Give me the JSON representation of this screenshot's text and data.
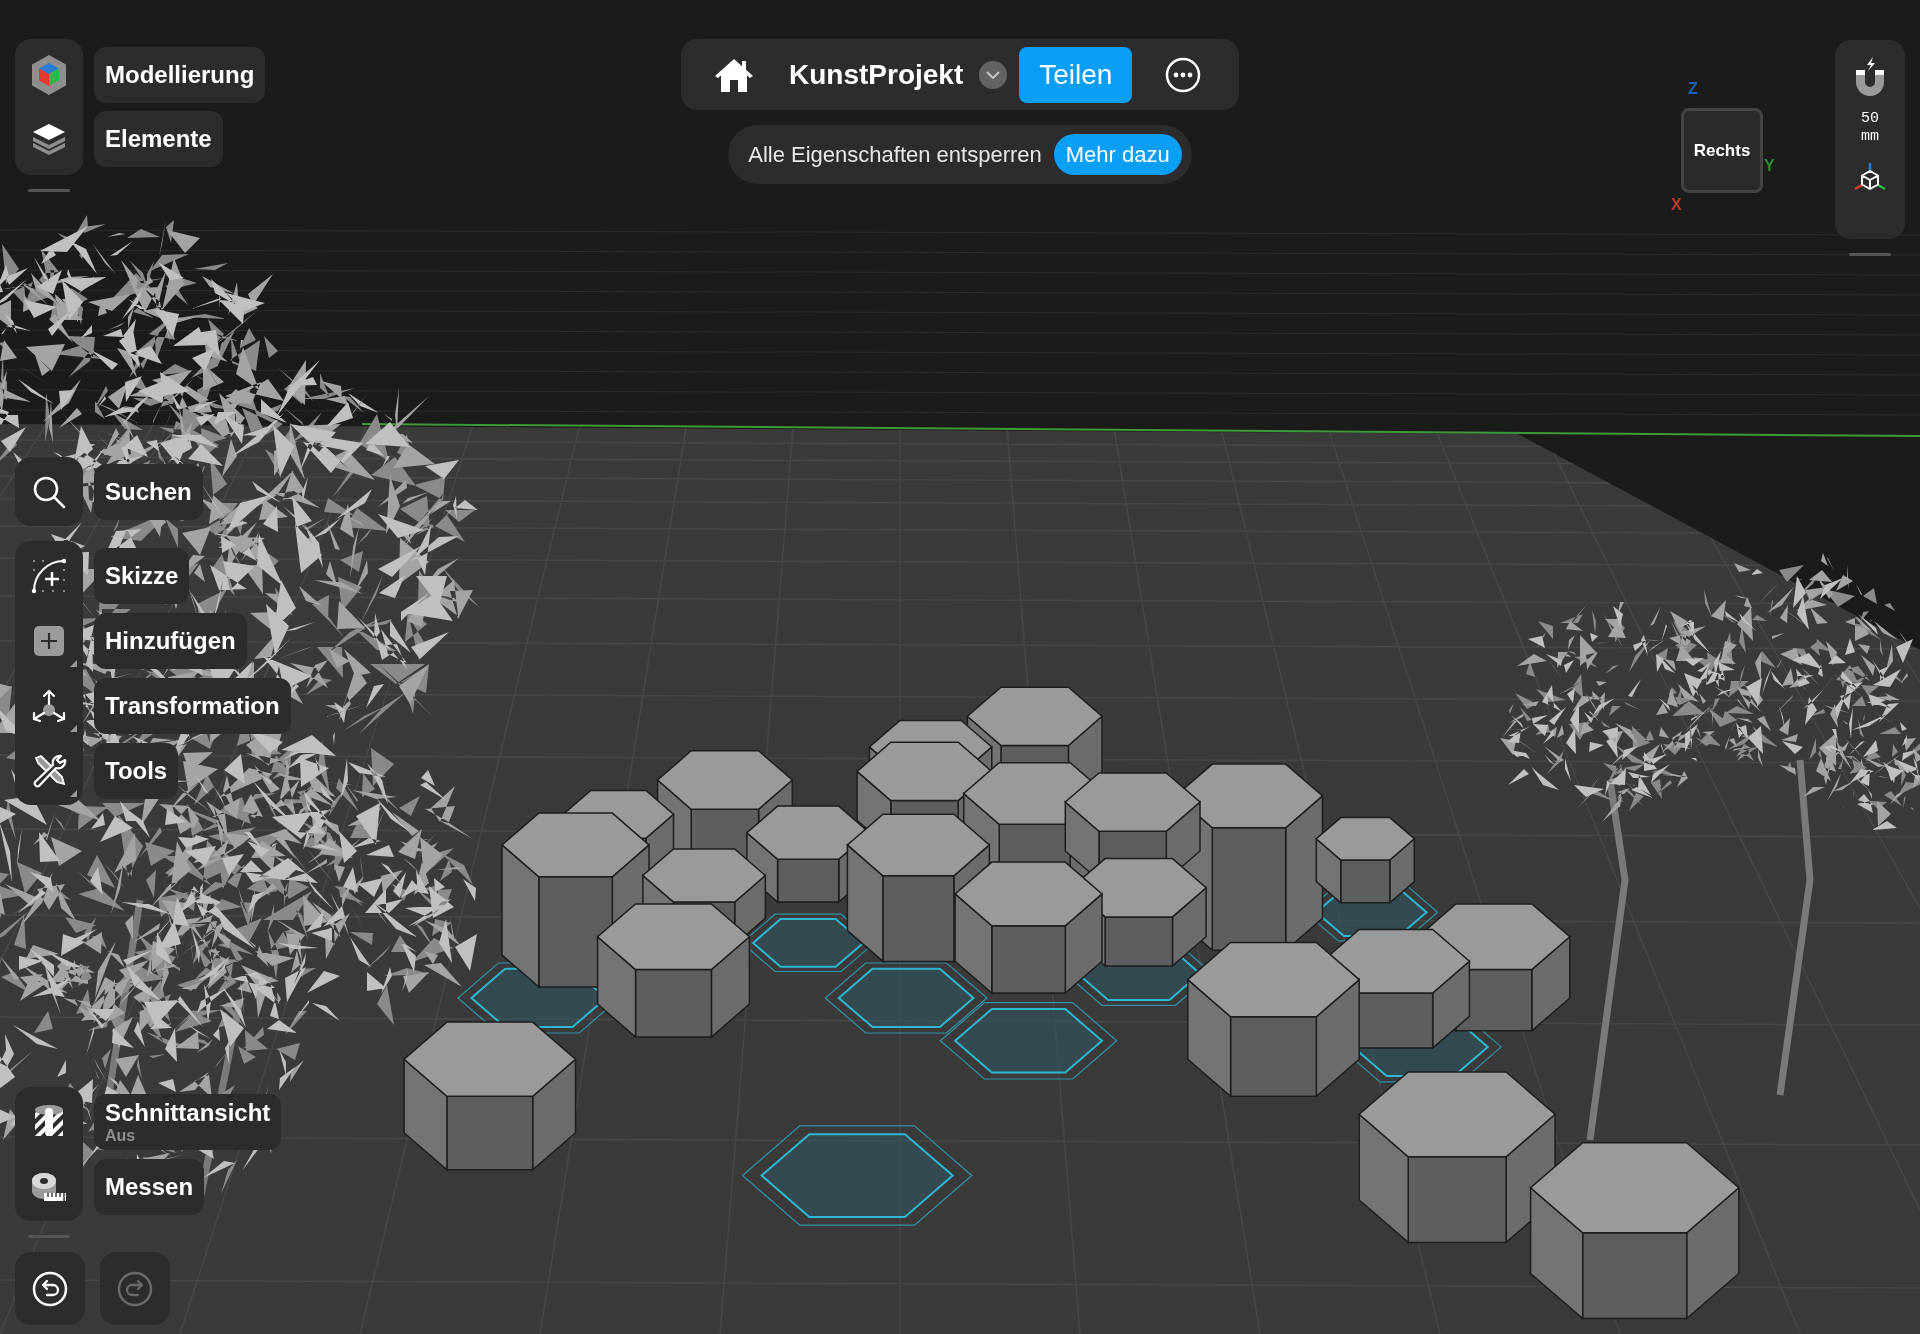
{
  "left_toolbar": {
    "workspace": [
      {
        "kind": "modeling",
        "label": "Modellierung"
      },
      {
        "kind": "layers",
        "label": "Elemente"
      }
    ],
    "search": {
      "kind": "search",
      "label": "Suchen"
    },
    "tools": [
      {
        "kind": "sketch",
        "label": "Skizze"
      },
      {
        "kind": "add",
        "label": "Hinzufügen"
      },
      {
        "kind": "transform",
        "label": "Transformation"
      },
      {
        "kind": "tools",
        "label": "Tools"
      }
    ],
    "view_tools": [
      {
        "kind": "section",
        "label": "Schnittansicht",
        "sublabel": "Aus"
      },
      {
        "kind": "measure",
        "label": "Messen"
      }
    ],
    "history": [
      {
        "kind": "undo",
        "disabled": false
      },
      {
        "kind": "redo",
        "disabled": true
      }
    ]
  },
  "top_bar": {
    "project_name": "KunstProjekt",
    "share_button": "Teilen"
  },
  "promo_banner": {
    "text": "Alle Eigenschaften entsperren",
    "link": "Mehr dazu"
  },
  "view_cube": {
    "face": "Rechts",
    "axes": [
      {
        "label": "Z",
        "color": "#1f5fae"
      },
      {
        "label": "Y",
        "color": "#2e8b2e"
      },
      {
        "label": "X",
        "color": "#b03a2e"
      }
    ]
  },
  "snap_panel": {
    "grid_value": "50",
    "grid_unit": "mm"
  }
}
